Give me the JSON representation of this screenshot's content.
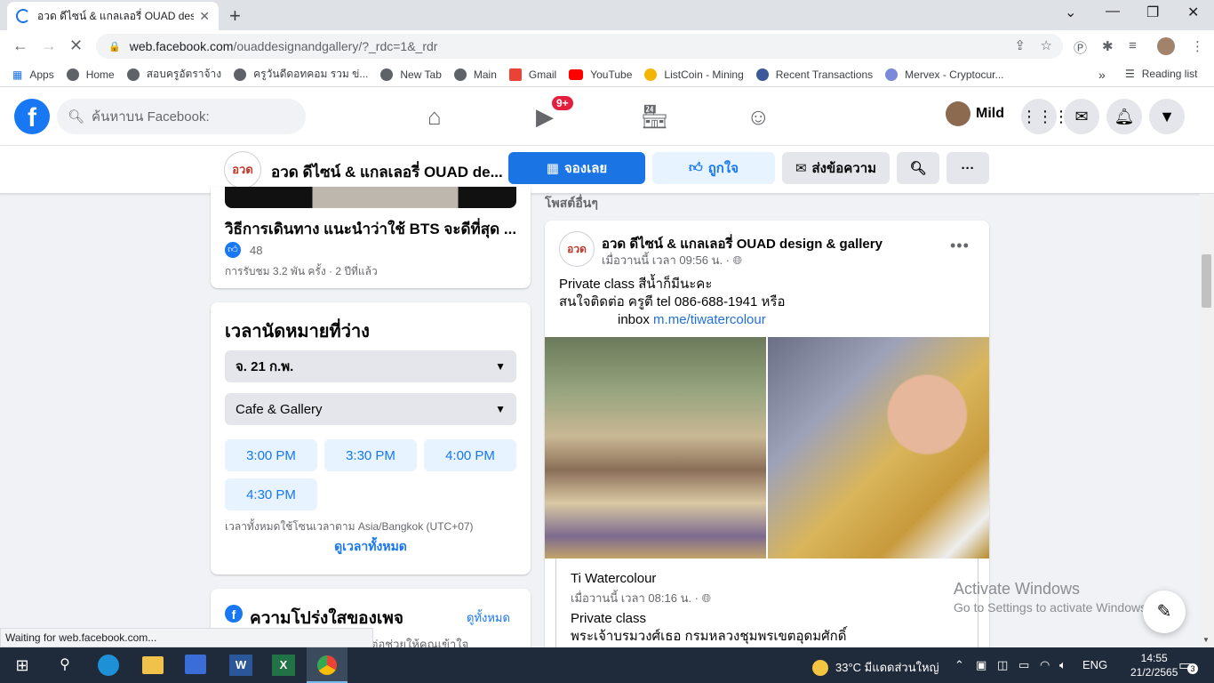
{
  "browser": {
    "tab_title": "อวด ดีไซน์ & แกลเลอรี่ OUAD design",
    "new_tab": "+",
    "url_host": "web.facebook.com",
    "url_path": "/ouaddesignandgallery/?_rdc=1&_rdr",
    "status_text": "Waiting for web.facebook.com...",
    "window_controls": {
      "minimize": "—",
      "restore": "❐",
      "close": "✕"
    },
    "tab_dropdown": "⌄"
  },
  "bookmarks": {
    "items": [
      "Apps",
      "Home",
      "สอบครูอัตราจ้าง",
      "ครูวันดีดอทคอม รวม ข่...",
      "New Tab",
      "Main",
      "Gmail",
      "YouTube",
      "ListCoin - Mining",
      "Recent Transactions",
      "Mervex - Cryptocur..."
    ],
    "more": "»",
    "reading_list": "Reading list"
  },
  "facebook": {
    "logo": "f",
    "search_placeholder": "ค้นหาบน Facebook:",
    "watch_badge": "9+",
    "user_name": "Mild"
  },
  "page": {
    "logo_text": "อวด",
    "name": "อวด ดีไซน์ & แกลเลอรี่ OUAD de...",
    "book_label": "จองเลย",
    "like_label": "ถูกใจ",
    "message_label": "ส่งข้อความ",
    "more_label": "···"
  },
  "video": {
    "title": "วิธีการเดินทาง แนะนำว่าใช้ BTS จะดีที่สุด ...",
    "likes": "48",
    "meta": "การรับชม 3.2 พัน ครั้ง · 2 ปีที่แล้ว"
  },
  "appointments": {
    "heading": "เวลานัดหมายที่ว่าง",
    "date": "จ. 21 ก.พ.",
    "service": "Cafe & Gallery",
    "slots": [
      "3:00 PM",
      "3:30 PM",
      "4:00 PM",
      "4:30 PM"
    ],
    "timezone": "เวลาทั้งหมดใช้โซนเวลาตาม Asia/Bangkok (UTC+07)",
    "see_all": "ดูเวลาทั้งหมด"
  },
  "transparency": {
    "heading": "ความโปร่งใสของเพจ",
    "see_all": "ดูทั้งหมด",
    "sub": "ต่อช่วยให้คุณเข้าใจ"
  },
  "feed": {
    "section_title": "โพสต์อื่นๆ",
    "post": {
      "author": "อวด ดีไซน์ & แกลเลอรี่ OUAD design & gallery",
      "time": "เมื่อวานนี้ เวลา 09:56 น. · ",
      "line1": "Private class สีน้ำก็มีนะคะ",
      "line2": "สนใจติดต่อ ครูตี tel 086-688-1941 หรือ",
      "line3_prefix": "inbox ",
      "link": "m.me/tiwatercolour",
      "shared": {
        "author": "Ti Watercolour",
        "time": "เมื่อวานนี้ เวลา 08:16 น. · ",
        "line1": "Private class",
        "line2": "พระเจ้าบรมวงศ์เธอ กรมหลวงชุมพรเขตอุดมศักดิ์"
      }
    }
  },
  "watermark": {
    "line1": "Activate Windows",
    "line2": "Go to Settings to activate Windows."
  },
  "taskbar": {
    "weather": "33°C  มีแดดส่วนใหญ่",
    "lang": "ENG",
    "time": "14:55",
    "date": "21/2/2565",
    "notifications": "3"
  }
}
